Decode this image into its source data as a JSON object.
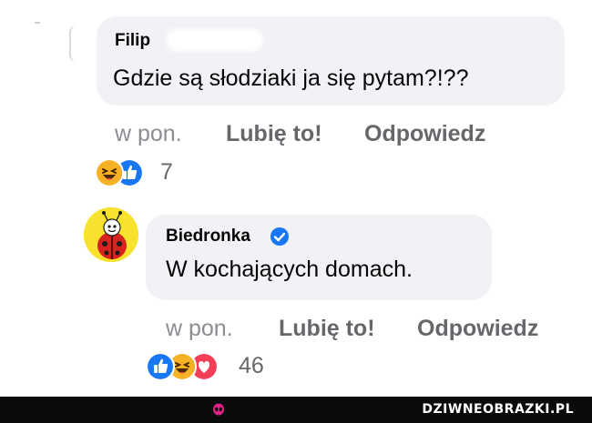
{
  "comment_1": {
    "author": "Filip",
    "text": "Gdzie są słodziaki ja się pytam?!??",
    "time": "w pon.",
    "like_label": "Lubię to!",
    "reply_label": "Odpowiedz",
    "reaction_count": "7",
    "reactions": [
      "haha-icon",
      "like-icon"
    ]
  },
  "comment_2": {
    "author": "Biedronka",
    "verified": true,
    "text": "W kochających domach.",
    "time": "w pon.",
    "like_label": "Lubię to!",
    "reply_label": "Odpowiedz",
    "reaction_count": "46",
    "reactions": [
      "like-icon",
      "haha-icon",
      "love-icon"
    ]
  },
  "footer": {
    "brand": "DZIWNEOBRAZKI.PL"
  },
  "colors": {
    "bubble": "#f0f2f5",
    "action_link": "#65676b",
    "time": "#8a8d91",
    "like_blue": "#1877f2",
    "love_red": "#f33e58",
    "haha_yellow": "#f7b125",
    "footer_bg": "#0b0b0b",
    "footer_logo": "#e0218a"
  }
}
